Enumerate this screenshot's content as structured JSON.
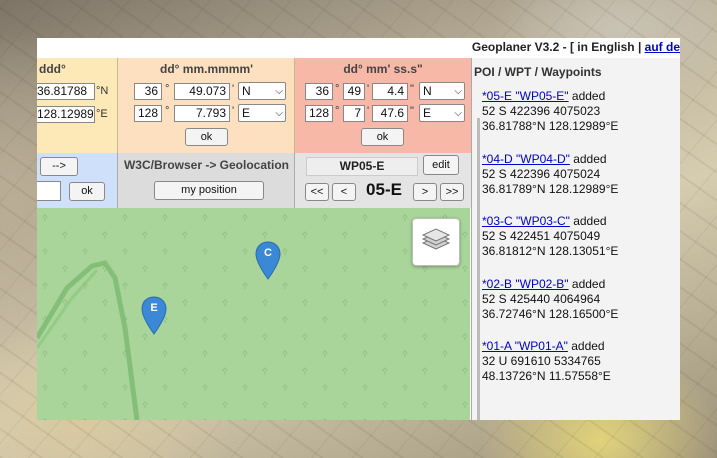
{
  "app": {
    "title_prefix": "Geoplaner V3.2 - [ ",
    "title_lang": "in English",
    "title_sep": " | ",
    "title_link": "auf de"
  },
  "dec": {
    "header": "ddd°",
    "lat": "36.81788",
    "lat_dir": "°N",
    "lon": "128.12989",
    "lon_dir": "°E"
  },
  "dm": {
    "header": "dd° mm.mmmm'",
    "lat_deg": "36",
    "lat_min": "49.073",
    "lat_hem": "N",
    "lon_deg": "128",
    "lon_min": "7.793",
    "lon_hem": "E",
    "ok": "ok",
    "deg_sym": "°",
    "min_sym": "'"
  },
  "dms": {
    "header": "dd° mm' ss.s\"",
    "lat_deg": "36",
    "lat_min": "49",
    "lat_sec": "4.4",
    "lat_hem": "N",
    "lon_deg": "128",
    "lon_min": "7",
    "lon_sec": "47.6",
    "lon_hem": "E",
    "ok": "ok",
    "deg_sym": "°",
    "min_sym": "'",
    "sec_sym": "\""
  },
  "convert": {
    "arrow_btn": "-->",
    "ok": "ok"
  },
  "geoloc": {
    "label": "W3C/Browser -> Geolocation",
    "button": "my position"
  },
  "wpnav": {
    "name": "WP05-E",
    "edit": "edit",
    "first": "<<",
    "prev": "<",
    "current": "05-E",
    "next": ">",
    "last": ">>"
  },
  "map": {
    "markers": [
      {
        "label": "C"
      },
      {
        "label": "E"
      }
    ],
    "layers_icon": "layers-icon"
  },
  "poi": {
    "header": "POI / WPT / Waypoints",
    "added": " added",
    "entries": [
      {
        "link": "*05-E \"WP05-E\"",
        "utm": "52 S 422396 4075023",
        "coord": "36.81788°N 128.12989°E"
      },
      {
        "link": "*04-D \"WP04-D\"",
        "utm": "52 S 422396 4075024",
        "coord": "36.81789°N 128.12989°E"
      },
      {
        "link": "*03-C \"WP03-C\"",
        "utm": "52 S 422451 4075049",
        "coord": "36.81812°N 128.13051°E"
      },
      {
        "link": "*02-B \"WP02-B\"",
        "utm": "52 S 425440 4064964",
        "coord": "36.72746°N 128.16500°E"
      },
      {
        "link": "*01-A \"WP01-A\"",
        "utm": "32 U 691610 5334765",
        "coord": "48.13726°N 11.57558°E"
      }
    ]
  },
  "colors": {
    "marker": "#3a88d6",
    "map_bg": "#a9d49a",
    "link": "#0000cc"
  }
}
